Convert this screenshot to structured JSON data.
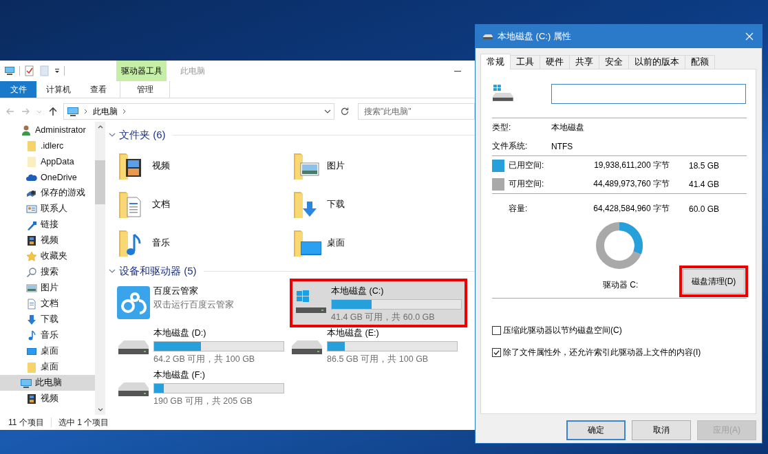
{
  "explorer": {
    "title": "此电脑",
    "ribbon_tabs": [
      {
        "label": "文件",
        "kind": "file",
        "selected": false
      },
      {
        "label": "计算机",
        "kind": "tab",
        "selected": false
      },
      {
        "label": "查看",
        "kind": "tab",
        "selected": false
      }
    ],
    "context_tab": {
      "group": "驱动器工具",
      "label": "管理",
      "selected": false
    },
    "address": {
      "crumbs": [
        "此电脑"
      ]
    },
    "search": {
      "placeholder": "搜索\"此电脑\""
    },
    "nav": {
      "items": [
        {
          "label": "Administrator",
          "kind": "user",
          "selected": false,
          "children": [
            {
              "label": ".idlerc",
              "kind": "folder",
              "selected": false
            },
            {
              "label": "AppData",
              "kind": "hidden-folder",
              "selected": false
            },
            {
              "label": "OneDrive",
              "kind": "cloud",
              "selected": false
            },
            {
              "label": "保存的游戏",
              "kind": "games",
              "selected": false
            },
            {
              "label": "联系人",
              "kind": "contacts",
              "selected": false
            },
            {
              "label": "链接",
              "kind": "link",
              "selected": false
            },
            {
              "label": "视频",
              "kind": "video",
              "selected": false
            },
            {
              "label": "收藏夹",
              "kind": "star",
              "selected": false
            },
            {
              "label": "搜索",
              "kind": "search",
              "selected": false
            },
            {
              "label": "图片",
              "kind": "picture",
              "selected": false
            },
            {
              "label": "文档",
              "kind": "document",
              "selected": false
            },
            {
              "label": "下载",
              "kind": "download",
              "selected": false
            },
            {
              "label": "音乐",
              "kind": "music",
              "selected": false
            },
            {
              "label": "桌面",
              "kind": "desktop",
              "selected": false
            },
            {
              "label": "桌面",
              "kind": "folder",
              "selected": false
            }
          ]
        },
        {
          "label": "此电脑",
          "kind": "pc",
          "selected": true,
          "children": [
            {
              "label": "视频",
              "kind": "video",
              "selected": false
            }
          ]
        }
      ]
    },
    "sections": [
      {
        "title": "文件夹 (6)",
        "kind": "folders",
        "items": [
          {
            "label": "视频",
            "kind": "video"
          },
          {
            "label": "图片",
            "kind": "picture"
          },
          {
            "label": "文档",
            "kind": "document"
          },
          {
            "label": "下载",
            "kind": "download"
          },
          {
            "label": "音乐",
            "kind": "music"
          },
          {
            "label": "桌面",
            "kind": "desktop"
          }
        ]
      },
      {
        "title": "设备和驱动器 (5)",
        "kind": "drives",
        "items": [
          {
            "kind": "app",
            "label": "百度云管家",
            "subtitle": "双击运行百度云管家",
            "selected": false,
            "annotated": false
          },
          {
            "kind": "system",
            "label": "本地磁盘 (C:)",
            "level": 0.31,
            "free": "41.4 GB 可用，共 60.0 GB",
            "selected": true,
            "annotated": true
          },
          {
            "kind": "local",
            "label": "本地磁盘 (D:)",
            "level": 0.36,
            "free": "64.2 GB 可用，共 100 GB",
            "selected": false,
            "annotated": false
          },
          {
            "kind": "local",
            "label": "本地磁盘 (E:)",
            "level": 0.135,
            "free": "86.5 GB 可用，共 100 GB",
            "selected": false,
            "annotated": false
          },
          {
            "kind": "local",
            "label": "本地磁盘 (F:)",
            "level": 0.073,
            "free": "190 GB 可用，共 205 GB",
            "selected": false,
            "annotated": false
          }
        ]
      }
    ],
    "status": [
      "11 个项目",
      "选中 1 个项目"
    ]
  },
  "dialog": {
    "title": "本地磁盘 (C:) 属性",
    "tabs": [
      {
        "label": "常规",
        "selected": true
      },
      {
        "label": "工具",
        "selected": false
      },
      {
        "label": "硬件",
        "selected": false
      },
      {
        "label": "共享",
        "selected": false
      },
      {
        "label": "安全",
        "selected": false
      },
      {
        "label": "以前的版本",
        "selected": false
      },
      {
        "label": "配额",
        "selected": false
      }
    ],
    "info": [
      {
        "label": "类型:",
        "value": "本地磁盘"
      },
      {
        "label": "文件系统:",
        "value": "NTFS"
      }
    ],
    "space": [
      {
        "label": "已用空间:",
        "bytes": "19,938,611,200 字节",
        "size": "18.5 GB",
        "color": "#26a0da"
      },
      {
        "label": "可用空间:",
        "bytes": "44,489,973,760 字节",
        "size": "41.4 GB",
        "color": "#a9a9a9"
      }
    ],
    "capacity": {
      "label": "容量:",
      "bytes": "64,428,584,960 字节",
      "size": "60.0 GB"
    },
    "drive_label": "驱动器 C:",
    "cleanup_button": {
      "label": "磁盘清理(D)",
      "annotated": true
    },
    "options": [
      {
        "label": "压缩此驱动器以节约磁盘空间(C)",
        "checked": false
      },
      {
        "label": "除了文件属性外，还允许索引此驱动器上文件的内容(I)",
        "checked": true
      }
    ],
    "buttons": [
      {
        "label": "确定",
        "kind": "default",
        "disabled": false
      },
      {
        "label": "取消",
        "kind": "normal",
        "disabled": false
      },
      {
        "label": "应用(A)",
        "kind": "normal",
        "disabled": true
      }
    ]
  }
}
